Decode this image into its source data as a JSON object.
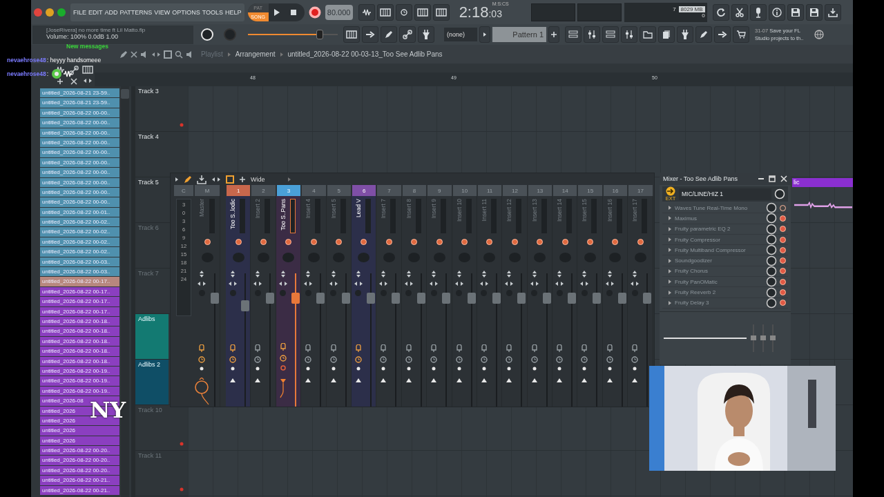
{
  "menu_bar": {
    "items": [
      "FILE",
      "EDIT",
      "ADD",
      "PATTERNS",
      "VIEW",
      "OPTIONS",
      "TOOLS",
      "HELP"
    ]
  },
  "transport": {
    "modes": [
      {
        "label": "PAT",
        "selected": false
      },
      {
        "label": "SONG",
        "selected": true
      }
    ],
    "recording": true,
    "tempo": "80.000"
  },
  "time": {
    "value": "2:18",
    "fraction": ":03",
    "unit": "M:S:CS"
  },
  "memory": {
    "voices": "7",
    "ram": "8029 MB",
    "cpu": "0"
  },
  "song_info": {
    "title": "[JoseRivera] no more time ft Lil Matto.flp",
    "volume": "Volume: 100%  0.0dB  1.00"
  },
  "master_volume": {
    "level": 0.8
  },
  "pattern": {
    "channel": "(none)",
    "name": "Pattern 1"
  },
  "news": {
    "date": "31-07",
    "text": "Save your FL Studio projects to th.."
  },
  "chat": {
    "banner": "New messages",
    "messages": [
      {
        "user": "nevaehrose48",
        "text": ": heyyy handsomeee",
        "kind": "text"
      },
      {
        "user": "nevaehrose48",
        "text": ":",
        "kind": "emote"
      }
    ]
  },
  "playlist": {
    "breadcrumb": [
      "Playlist",
      "Arrangement",
      "untitled_2026-08-22 00-03-13_Too See Adlib Pans"
    ],
    "ruler": [
      "48",
      "49",
      "50"
    ],
    "tracks": [
      {
        "name": "Track 3",
        "active": true,
        "marker": true
      },
      {
        "name": "Track 4",
        "active": true,
        "marker": false
      },
      {
        "name": "Track 5",
        "active": true,
        "marker": false
      },
      {
        "name": "Track 6",
        "active": false,
        "marker": false
      },
      {
        "name": "Track 7",
        "active": false,
        "marker": false
      },
      {
        "name": "Adlibs",
        "active": true,
        "marker": false,
        "color": "#137a72"
      },
      {
        "name": "Adlibs 2",
        "active": true,
        "marker": false,
        "color": "#0f4e66"
      },
      {
        "name": "Track 10",
        "active": false,
        "marker": true
      },
      {
        "name": "Track 11",
        "active": false,
        "marker": true
      }
    ],
    "clip": {
      "label": "lic",
      "color": "#8a2fd0"
    }
  },
  "browser": {
    "files": [
      {
        "name": "untitled_2026-08-21 23-59..",
        "color": "#4f90ae"
      },
      {
        "name": "untitled_2026-08-21 23-59..",
        "color": "#4f90ae"
      },
      {
        "name": "untitled_2026-08-22 00-00..",
        "color": "#4f90ae"
      },
      {
        "name": "untitled_2026-08-22 00-00..",
        "color": "#4f90ae"
      },
      {
        "name": "untitled_2026-08-22 00-00..",
        "color": "#4f90ae"
      },
      {
        "name": "untitled_2026-08-22 00-00..",
        "color": "#4f90ae"
      },
      {
        "name": "untitled_2026-08-22 00-00..",
        "color": "#4f90ae"
      },
      {
        "name": "untitled_2026-08-22 00-00..",
        "color": "#4f90ae"
      },
      {
        "name": "untitled_2026-08-22 00-00..",
        "color": "#4f90ae"
      },
      {
        "name": "untitled_2026-08-22 00-00..",
        "color": "#4f90ae"
      },
      {
        "name": "untitled_2026-08-22 00-00..",
        "color": "#4f90ae"
      },
      {
        "name": "untitled_2026-08-22 00-00..",
        "color": "#4f90ae"
      },
      {
        "name": "untitled_2026-08-22 00-01..",
        "color": "#4f90ae"
      },
      {
        "name": "untitled_2026-08-22 00-02..",
        "color": "#4f90ae"
      },
      {
        "name": "untitled_2026-08-22 00-02..",
        "color": "#4f90ae"
      },
      {
        "name": "untitled_2026-08-22 00-02..",
        "color": "#4f90ae"
      },
      {
        "name": "untitled_2026-08-22 00-02..",
        "color": "#4f90ae"
      },
      {
        "name": "untitled_2026-08-22 00-03..",
        "color": "#4f90ae"
      },
      {
        "name": "untitled_2026-08-22 00-03..",
        "color": "#4f90ae"
      },
      {
        "name": "untitled_2026-08-22 00-17..",
        "color": "#b7877e"
      },
      {
        "name": "untitled_2026-08-22 00-17..",
        "color": "#8b3fc0"
      },
      {
        "name": "untitled_2026-08-22 00-17..",
        "color": "#8b3fc0"
      },
      {
        "name": "untitled_2026-08-22 00-17..",
        "color": "#8b3fc0"
      },
      {
        "name": "untitled_2026-08-22 00-18..",
        "color": "#8b3fc0"
      },
      {
        "name": "untitled_2026-08-22 00-18..",
        "color": "#8b3fc0"
      },
      {
        "name": "untitled_2026-08-22 00-18..",
        "color": "#8b3fc0"
      },
      {
        "name": "untitled_2026-08-22 00-18..",
        "color": "#8b3fc0"
      },
      {
        "name": "untitled_2026-08-22 00-18..",
        "color": "#8b3fc0"
      },
      {
        "name": "untitled_2026-08-22 00-19..",
        "color": "#8b3fc0"
      },
      {
        "name": "untitled_2026-08-22 00-19..",
        "color": "#8b3fc0"
      },
      {
        "name": "untitled_2026-08-22 00-19..",
        "color": "#8b3fc0"
      },
      {
        "name": "untitled_2026-08",
        "color": "#8b3fc0"
      },
      {
        "name": "untitled_2026",
        "color": "#8b3fc0"
      },
      {
        "name": "untitled_2026",
        "color": "#8b3fc0"
      },
      {
        "name": "untitled_2026",
        "color": "#8b3fc0"
      },
      {
        "name": "untitled_2026",
        "color": "#8b3fc0"
      },
      {
        "name": "untitled_2026-08-22 00-20..",
        "color": "#8b3fc0"
      },
      {
        "name": "untitled_2026-08-22 00-20..",
        "color": "#8b3fc0"
      },
      {
        "name": "untitled_2026-08-22 00-20..",
        "color": "#8b3fc0"
      },
      {
        "name": "untitled_2026-08-22 00-21..",
        "color": "#8b3fc0"
      },
      {
        "name": "untitled_2026-08-22 00-21..",
        "color": "#8b3fc0"
      }
    ]
  },
  "overlay_logo": "NY",
  "mixer": {
    "stereo_mode": "Wide",
    "scale": {
      "header": "C",
      "ticks": [
        "3",
        "0",
        "3",
        "6",
        "9",
        "12",
        "15",
        "18",
        "21",
        "24"
      ]
    },
    "strips": [
      {
        "header": "M",
        "name": "Master",
        "kind": "master",
        "named": false,
        "tinted": false,
        "selected": false,
        "routed": true,
        "level": 0.84
      },
      {
        "header": "1",
        "name": "Too S..lodic",
        "kind": "insert",
        "named": true,
        "tinted": true,
        "selected": false,
        "routed": true,
        "level": 0.78,
        "color": "#c8674c"
      },
      {
        "header": "2",
        "name": "Insert 2",
        "kind": "insert",
        "named": false,
        "tinted": false,
        "selected": false,
        "routed": false,
        "level": 0.84
      },
      {
        "header": "3",
        "name": "Too S..Pans",
        "kind": "insert",
        "named": true,
        "tinted": false,
        "selected": true,
        "routed": true,
        "level": 0.84,
        "color": "#4aa0d8"
      },
      {
        "header": "4",
        "name": "Insert 4",
        "kind": "insert",
        "named": false,
        "tinted": false,
        "selected": false,
        "routed": false,
        "level": 0.84
      },
      {
        "header": "5",
        "name": "Insert 5",
        "kind": "insert",
        "named": false,
        "tinted": false,
        "selected": false,
        "routed": false,
        "level": 0.84
      },
      {
        "header": "6",
        "name": "Lead V",
        "kind": "insert",
        "named": true,
        "tinted": true,
        "selected": false,
        "routed": true,
        "level": 0.84,
        "color": "#7f4fa6"
      },
      {
        "header": "7",
        "name": "Insert 7",
        "kind": "insert",
        "named": false,
        "tinted": false,
        "selected": false,
        "routed": false,
        "level": 0.84
      },
      {
        "header": "8",
        "name": "Insert 8",
        "kind": "insert",
        "named": false,
        "tinted": false,
        "selected": false,
        "routed": false,
        "level": 0.84
      },
      {
        "header": "9",
        "name": "Insert 9",
        "kind": "insert",
        "named": false,
        "tinted": false,
        "selected": false,
        "routed": false,
        "level": 0.84
      },
      {
        "header": "10",
        "name": "Insert 10",
        "kind": "insert",
        "named": false,
        "tinted": false,
        "selected": false,
        "routed": false,
        "level": 0.84
      },
      {
        "header": "11",
        "name": "Insert 11",
        "kind": "insert",
        "named": false,
        "tinted": false,
        "selected": false,
        "routed": false,
        "level": 0.84
      },
      {
        "header": "12",
        "name": "Insert 12",
        "kind": "insert",
        "named": false,
        "tinted": false,
        "selected": false,
        "routed": false,
        "level": 0.84
      },
      {
        "header": "13",
        "name": "Insert 13",
        "kind": "insert",
        "named": false,
        "tinted": false,
        "selected": false,
        "routed": false,
        "level": 0.84
      },
      {
        "header": "14",
        "name": "Insert 14",
        "kind": "insert",
        "named": false,
        "tinted": false,
        "selected": false,
        "routed": false,
        "level": 0.84
      },
      {
        "header": "15",
        "name": "Insert 15",
        "kind": "insert",
        "named": false,
        "tinted": false,
        "selected": false,
        "routed": false,
        "level": 0.84
      },
      {
        "header": "16",
        "name": "Insert 16",
        "kind": "insert",
        "named": false,
        "tinted": false,
        "selected": false,
        "routed": false,
        "level": 0.84
      },
      {
        "header": "17",
        "name": "Insert 17",
        "kind": "insert",
        "named": false,
        "tinted": false,
        "selected": false,
        "routed": false,
        "level": 0.84
      }
    ]
  },
  "mixer_detail": {
    "title": "Mixer - Too See Adlib Pans",
    "input_badge": "EXT",
    "input": "MIC/LINE/HIZ 1",
    "slots": [
      {
        "name": "Waves Tune Real-Time Mono",
        "enabled": false
      },
      {
        "name": "Maximus",
        "enabled": true
      },
      {
        "name": "Fruity parametric EQ 2",
        "enabled": true
      },
      {
        "name": "Fruity Compressor",
        "enabled": true
      },
      {
        "name": "Fruity Multiband Compressor",
        "enabled": true
      },
      {
        "name": "Soundgoodizer",
        "enabled": true
      },
      {
        "name": "Fruity Chorus",
        "enabled": true
      },
      {
        "name": "Fruity PanOMatic",
        "enabled": true
      },
      {
        "name": "Fruity Reeverb 2",
        "enabled": true
      },
      {
        "name": "Fruity Delay 3",
        "enabled": true
      }
    ]
  }
}
